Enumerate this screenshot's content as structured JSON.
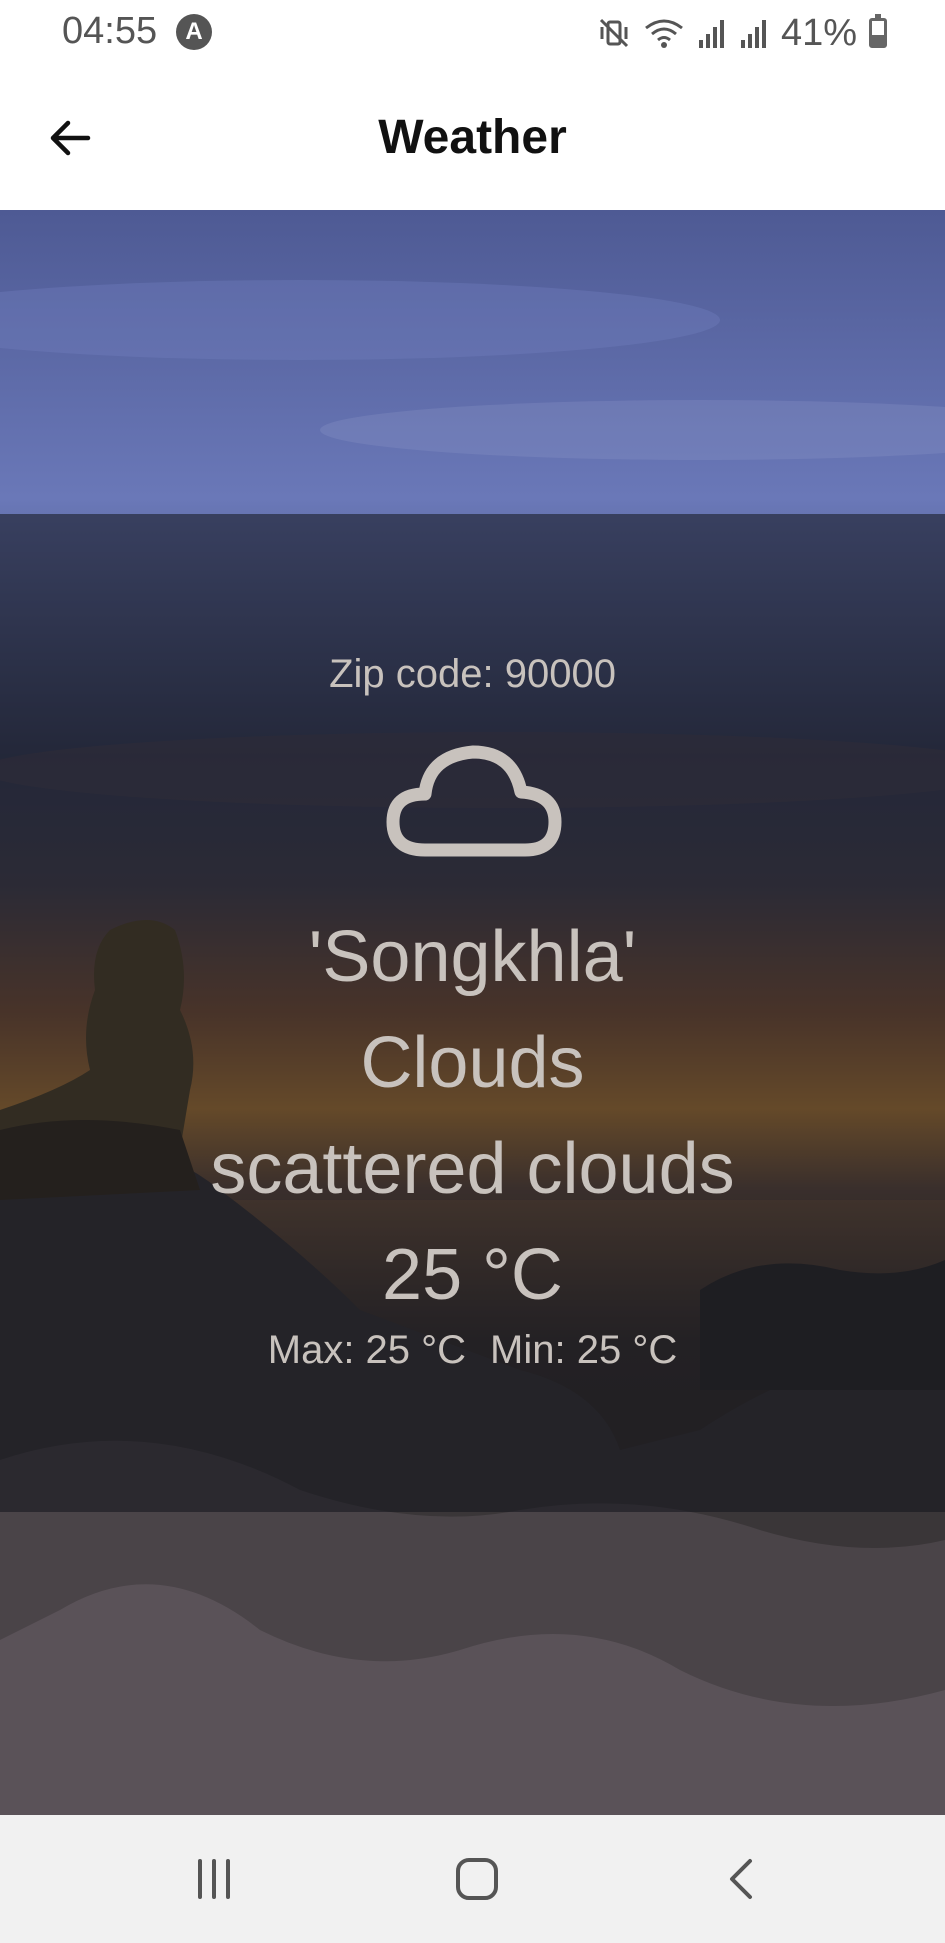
{
  "status_bar": {
    "time": "04:55",
    "badge": "A",
    "battery_text": "41%",
    "battery_level": 0.41,
    "icons": [
      "mute-vibrate-icon",
      "wifi-icon",
      "signal-icon",
      "signal-icon",
      "battery-icon"
    ]
  },
  "app_bar": {
    "title": "Weather",
    "back_icon": "arrow-left-icon"
  },
  "weather": {
    "zip_line": "Zip code: 90000",
    "icon": "cloud-icon",
    "city": "'Songkhla'",
    "main": "Clouds",
    "description": "scattered clouds",
    "temperature": "25 °C",
    "max": "Max: 25 °C",
    "min": "Min: 25 °C"
  },
  "nav_bar": {
    "buttons": [
      "recent-apps-icon",
      "home-icon",
      "back-icon"
    ]
  },
  "colors": {
    "overlay_text": "#c8c2bd",
    "sky_top": "#5a6aa6",
    "sunset": "#c8822f",
    "nav_background": "#f1f1f1"
  }
}
